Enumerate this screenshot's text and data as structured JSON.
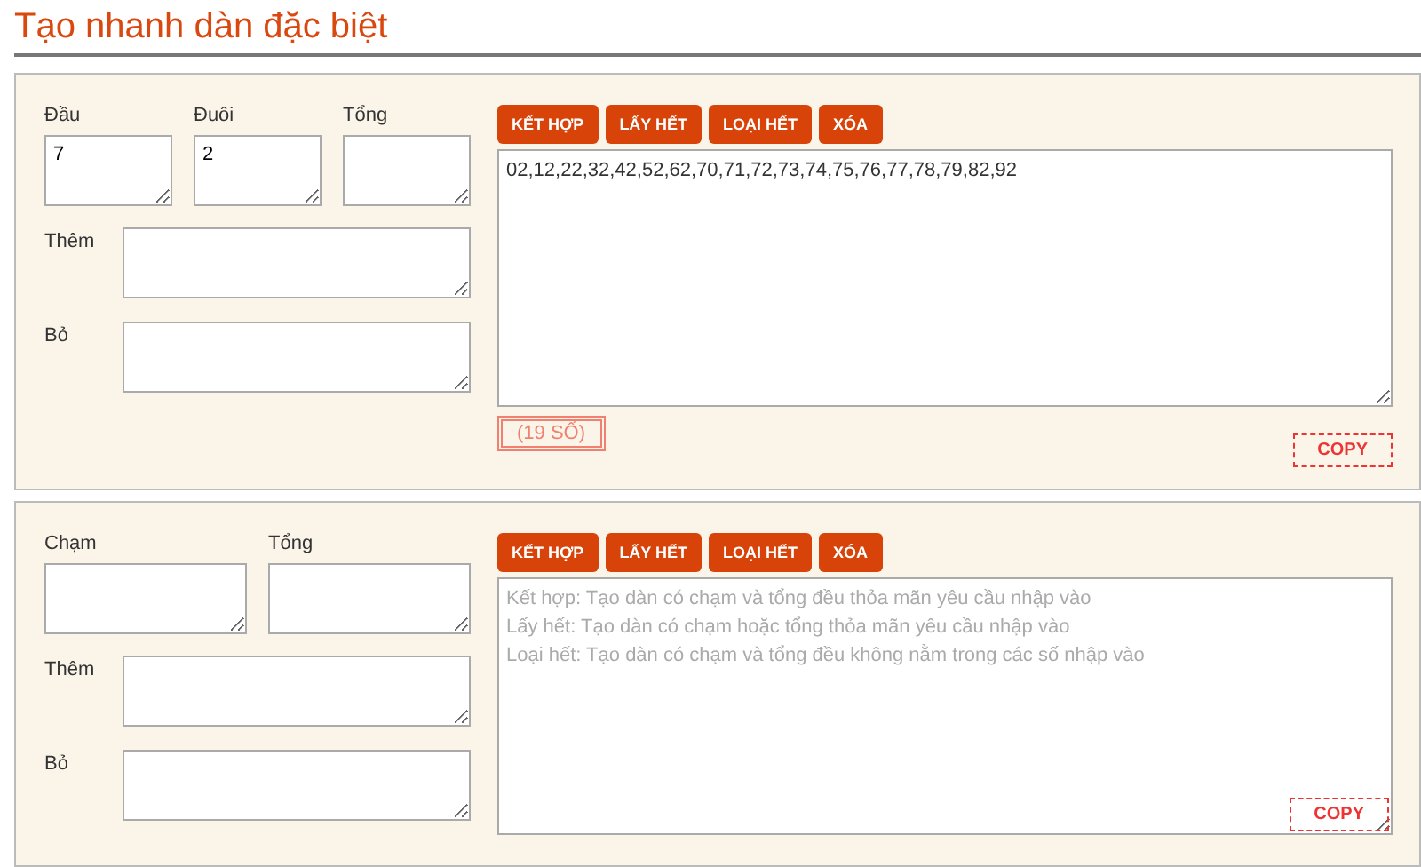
{
  "title": "Tạo nhanh dàn đặc biệt",
  "panels": [
    {
      "top_fields": [
        {
          "label": "Đầu",
          "value": "7"
        },
        {
          "label": "Đuôi",
          "value": "2"
        },
        {
          "label": "Tổng"
        }
      ],
      "side_fields": [
        {
          "label": "Thêm"
        },
        {
          "label": "Bỏ"
        }
      ],
      "buttons": [
        "KẾT HỢP",
        "LẤY HẾT",
        "LOẠI HẾT",
        "XÓA"
      ],
      "output": {
        "value": "02,12,22,32,42,52,62,70,71,72,73,74,75,76,77,78,79,82,92"
      },
      "count": "(19 SỐ)",
      "copy": "COPY",
      "copy_inside": false
    },
    {
      "top_fields": [
        {
          "label": "Chạm"
        },
        {
          "label": "Tổng"
        }
      ],
      "side_fields": [
        {
          "label": "Thêm"
        },
        {
          "label": "Bỏ"
        }
      ],
      "buttons": [
        "KẾT HỢP",
        "LẤY HẾT",
        "LOẠI HẾT",
        "XÓA"
      ],
      "output": {
        "placeholder_lines": [
          "Kết hợp: Tạo dàn có chạm và tổng đều thỏa mãn yêu cầu nhập vào",
          "Lấy hết: Tạo dàn có chạm hoặc tổng thỏa mãn yêu cầu nhập vào",
          "Loại hết: Tạo dàn có chạm và tổng đều không nằm trong các số nhập vào"
        ]
      },
      "copy": "COPY",
      "copy_inside": true
    }
  ]
}
